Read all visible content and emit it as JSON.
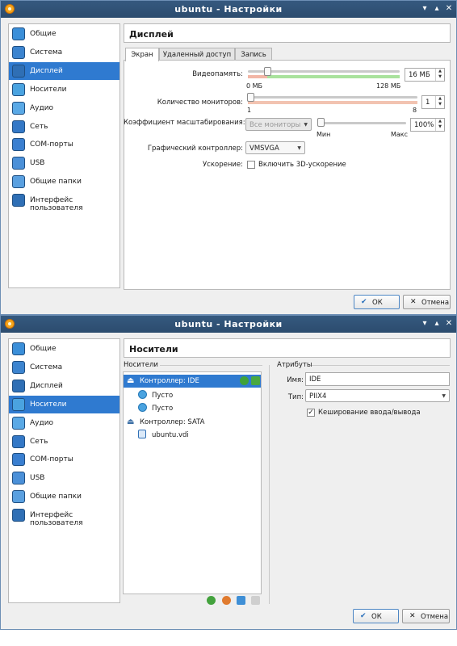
{
  "window1": {
    "title": "ubuntu - Настройки",
    "sidebar": [
      {
        "label": "Общие",
        "icon": "general-icon"
      },
      {
        "label": "Система",
        "icon": "system-icon"
      },
      {
        "label": "Дисплей",
        "icon": "display-icon",
        "selected": true
      },
      {
        "label": "Носители",
        "icon": "storage-icon"
      },
      {
        "label": "Аудио",
        "icon": "audio-icon"
      },
      {
        "label": "Сеть",
        "icon": "network-icon"
      },
      {
        "label": "COM-порты",
        "icon": "serial-ports-icon"
      },
      {
        "label": "USB",
        "icon": "usb-icon"
      },
      {
        "label": "Общие папки",
        "icon": "shared-folders-icon"
      },
      {
        "label": "Интерфейс пользователя",
        "icon": "user-interface-icon"
      }
    ],
    "header": "Дисплей",
    "tabs": [
      "Экран",
      "Удаленный доступ",
      "Запись"
    ],
    "video_memory": {
      "label": "Видеопамять:",
      "value": "16 МБ",
      "min": "0 МБ",
      "max": "128 МБ",
      "level": 0.125
    },
    "monitors": {
      "label": "Количество мониторов:",
      "value": "1",
      "min": "1",
      "max": "8",
      "level": 0.0
    },
    "scale": {
      "label": "Коэффициент масштабирования:",
      "combo": "Все мониторы",
      "min": "Мин",
      "max": "Макс",
      "value": "100%",
      "level": 0.0
    },
    "controller": {
      "label": "Графический контроллер:",
      "value": "VMSVGA"
    },
    "accel": {
      "label": "Ускорение:",
      "checkbox": "Включить 3D-ускорение",
      "checked": false
    },
    "ok": "ОК",
    "cancel": "Отмена"
  },
  "window2": {
    "title": "ubuntu - Настройки",
    "sidebar": [
      {
        "label": "Общие",
        "icon": "general-icon"
      },
      {
        "label": "Система",
        "icon": "system-icon"
      },
      {
        "label": "Дисплей",
        "icon": "display-icon"
      },
      {
        "label": "Носители",
        "icon": "storage-icon",
        "selected": true
      },
      {
        "label": "Аудио",
        "icon": "audio-icon"
      },
      {
        "label": "Сеть",
        "icon": "network-icon"
      },
      {
        "label": "COM-порты",
        "icon": "serial-ports-icon"
      },
      {
        "label": "USB",
        "icon": "usb-icon"
      },
      {
        "label": "Общие папки",
        "icon": "shared-folders-icon"
      },
      {
        "label": "Интерфейс пользователя",
        "icon": "user-interface-icon"
      }
    ],
    "header": "Носители",
    "storage_label": "Носители",
    "tree": [
      {
        "label": "Контроллер: IDE",
        "kind": "controller",
        "selected": true
      },
      {
        "label": "Пусто",
        "kind": "optical"
      },
      {
        "label": "Пусто",
        "kind": "optical"
      },
      {
        "label": "Контроллер: SATA",
        "kind": "controller"
      },
      {
        "label": "ubuntu.vdi",
        "kind": "disk"
      }
    ],
    "attributes": {
      "title": "Атрибуты",
      "name_label": "Имя:",
      "name_value": "IDE",
      "type_label": "Тип:",
      "type_value": "PIIX4",
      "cache_label": "Кеширование ввода/вывода",
      "cache_checked": true
    },
    "ok": "ОК",
    "cancel": "Отмена"
  }
}
